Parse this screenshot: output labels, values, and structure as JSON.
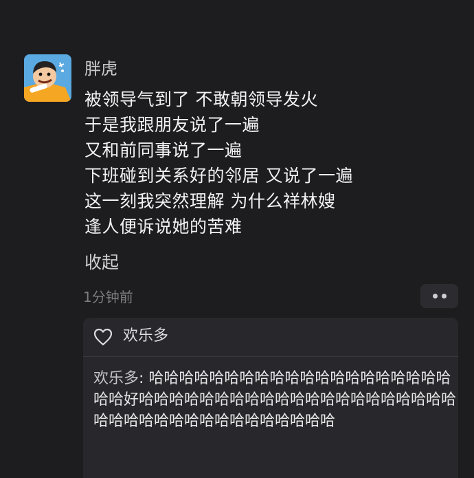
{
  "post": {
    "author": "胖虎",
    "lines": [
      "被领导气到了 不敢朝领导发火",
      "于是我跟朋友说了一遍",
      "又和前同事说了一遍",
      "下班碰到关系好的邻居 又说了一遍",
      "这一刻我突然理解 为什么祥林嫂",
      "逢人便诉说她的苦难"
    ],
    "collapse_label": "收起",
    "timestamp": "1分钟前"
  },
  "likes": {
    "names": "欢乐多"
  },
  "comments": [
    {
      "name": "欢乐多",
      "separator": ": ",
      "text": "哈哈哈哈哈哈哈哈哈哈哈哈哈哈哈哈哈哈哈哈哈哈好哈哈哈哈哈哈哈哈哈哈哈哈哈哈哈哈哈哈哈哈哈哈哈哈哈哈哈哈哈哈哈哈哈哈哈哈哈"
    }
  ],
  "icons": {
    "like": "heart-icon",
    "more": "more-dots-icon"
  },
  "colors": {
    "background": "#1d1d20",
    "panel": "#28282c",
    "author": "#c9c9cc",
    "timestamp": "#7d7d82"
  }
}
